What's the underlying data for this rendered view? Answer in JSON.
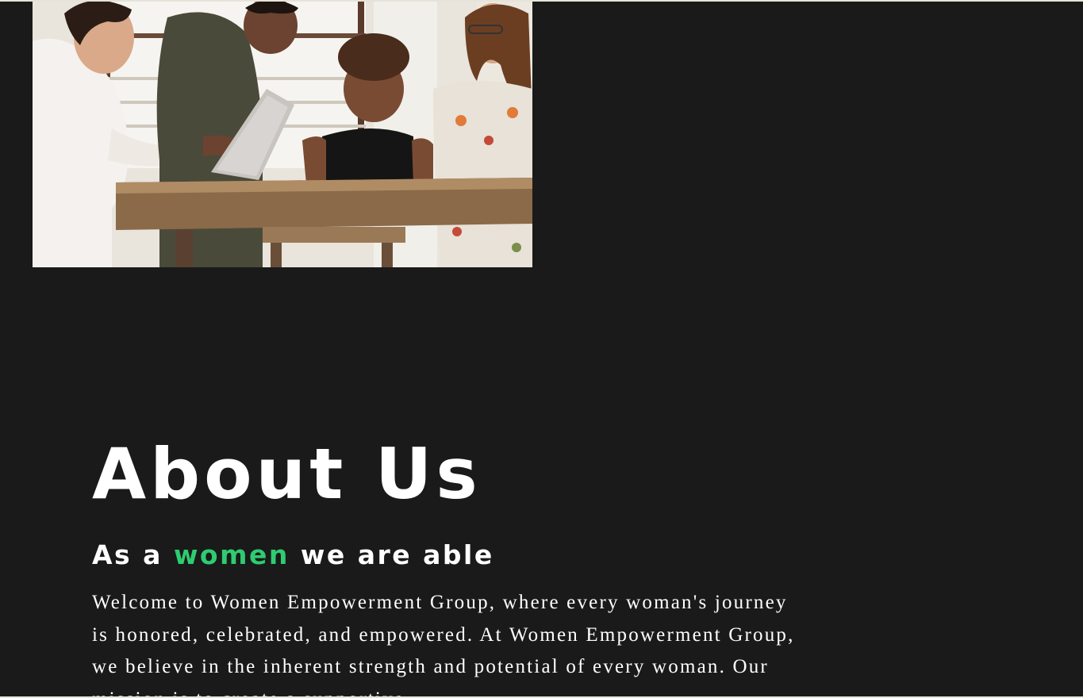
{
  "hero": {
    "image_alt": "Four women gathered around a laptop at a wooden table"
  },
  "about": {
    "title": "About Us",
    "tagline_prefix": "As a ",
    "tagline_accent": "women",
    "tagline_suffix": " we are able",
    "body": "Welcome to Women Empowerment Group, where every woman's journey is honored, celebrated, and empowered. At Women Empowerment Group, we believe in the inherent strength and potential of every woman. Our mission is to create a supportive"
  },
  "colors": {
    "background": "#1a1a1a",
    "text": "#ffffff",
    "accent": "#2ecc71"
  }
}
